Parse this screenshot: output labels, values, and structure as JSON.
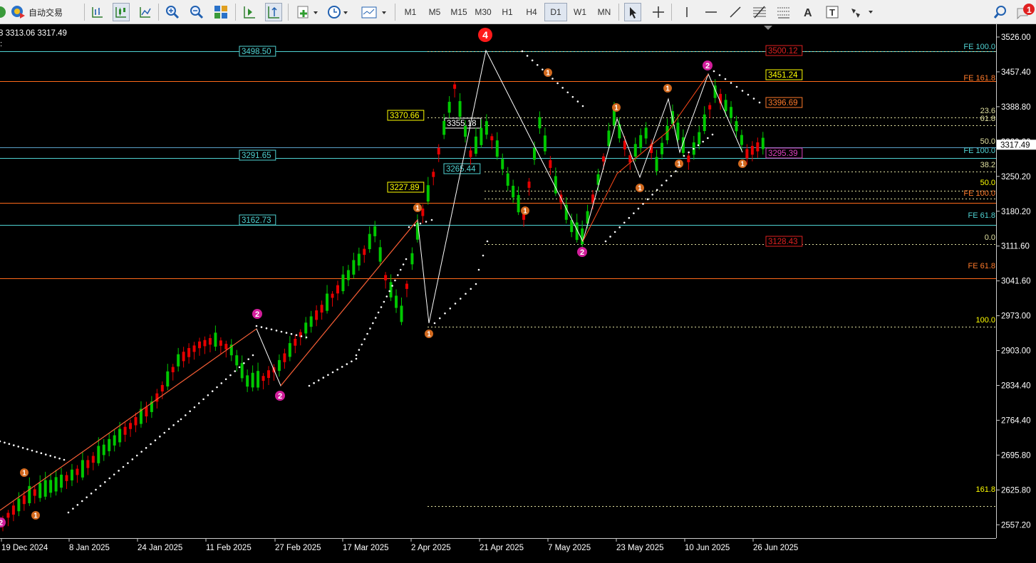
{
  "toolbar": {
    "autotrade_label": "自动交易",
    "timeframes": [
      "M1",
      "M5",
      "M15",
      "M30",
      "H1",
      "H4",
      "D1",
      "W1",
      "MN"
    ],
    "active_timeframe": "D1",
    "icons": [
      "chart-bars-icon",
      "candlesticks-icon",
      "line-chart-icon",
      "zoom-in-icon",
      "zoom-out-icon",
      "tile-windows-icon",
      "autoscroll-icon",
      "chart-shift-icon",
      "indicators-icon",
      "periods-icon",
      "templates-icon",
      "cursor-icon",
      "crosshair-icon",
      "vertical-line-icon",
      "horizontal-line-icon",
      "trendline-icon",
      "fibonacci-icon",
      "fib-expansion-icon",
      "text-icon",
      "text-label-icon",
      "shapes-icon",
      "search-icon",
      "notification-icon"
    ]
  },
  "chart": {
    "info_text": "8 3313.06 3317.49",
    "current_price": "3317.49",
    "price_axis": [
      "3526.00",
      "3457.40",
      "3388.80",
      "3320.20",
      "3250.20",
      "3180.20",
      "3111.60",
      "3041.60",
      "2973.00",
      "2903.00",
      "2834.40",
      "2764.40",
      "2695.80",
      "2625.80",
      "2557.20"
    ],
    "time_axis": [
      "19 Dec 2024",
      "8 Jan 2025",
      "24 Jan 2025",
      "11 Feb 2025",
      "27 Feb 2025",
      "17 Mar 2025",
      "2 Apr 2025",
      "21 Apr 2025",
      "7 May 2025",
      "23 May 2025",
      "10 Jun 2025",
      "26 Jun 2025"
    ],
    "price_labels": {
      "cyan": [
        "3498.50",
        "3291.65",
        "3162.73",
        "3265.44"
      ],
      "yellow": [
        "3370.66",
        "3227.89",
        "3451.24"
      ],
      "white": [
        "3355.18"
      ],
      "red": [
        "3500.12",
        "3128.43"
      ],
      "orange": [
        "3396.69"
      ],
      "magenta": [
        "3295.39"
      ]
    },
    "fib_labels": [
      "FE 100.0",
      "FE 161.8",
      "23.6",
      "61.8",
      "50.0",
      "FE 100.0",
      "38.2",
      "50.0",
      "FE 100.0",
      "FE 61.8",
      "0.0",
      "FE 61.8",
      "100.0",
      "161.8"
    ],
    "wave_labels": {
      "major": "4",
      "magenta": [
        "2",
        "2",
        "2",
        "2"
      ],
      "orange": [
        "1",
        "1",
        "1",
        "1",
        "1",
        "1",
        "1",
        "1",
        "1",
        "1",
        "1",
        "1",
        "1"
      ]
    },
    "colors": {
      "bull": "#00c800",
      "bear": "#e60000",
      "cyan_line": "#4fd2d2",
      "orange_line": "#ff6a1a",
      "yellow": "#ffff00",
      "magenta": "#d21e9b",
      "wave_orange": "#d2691e"
    }
  }
}
